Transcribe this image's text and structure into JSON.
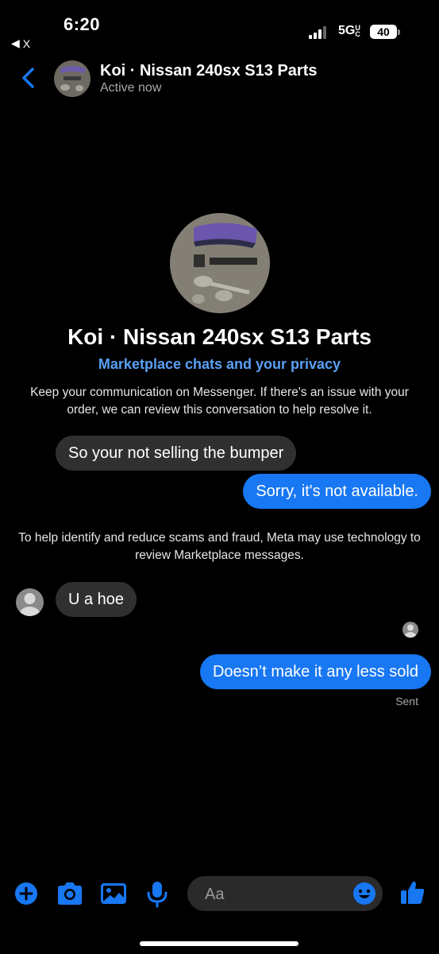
{
  "status_bar": {
    "time": "6:20",
    "back_app": "X",
    "network": "5G",
    "network_suffix": "UC",
    "battery": "40"
  },
  "header": {
    "title": "Koi · Nissan 240sx S13 Parts",
    "subtitle": "Active now"
  },
  "profile": {
    "name": "Koi · Nissan 240sx S13 Parts",
    "privacy_link": "Marketplace chats and your privacy",
    "notice": "Keep your communication on Messenger. If there's an issue with your order, we can review this conversation to help resolve it."
  },
  "messages": [
    {
      "direction": "incoming",
      "text": "So your not selling the bumper"
    },
    {
      "direction": "outgoing",
      "text": "Sorry, it's not available."
    },
    {
      "direction": "incoming",
      "text": "U a hoe"
    },
    {
      "direction": "outgoing",
      "text": "Doesn’t make it any less sold"
    }
  ],
  "scam_notice": "To help identify and reduce scams and fraud, Meta may use technology to review Marketplace messages.",
  "delivery_status": "Sent",
  "composer": {
    "placeholder": "Aa"
  },
  "colors": {
    "accent": "#1877f2",
    "link": "#5aa0f5",
    "incoming_bubble": "#303030",
    "background": "#000000"
  },
  "icons": [
    "back-chevron-icon",
    "plus-icon",
    "camera-icon",
    "photo-icon",
    "microphone-icon",
    "emoji-icon",
    "thumbs-up-icon"
  ]
}
